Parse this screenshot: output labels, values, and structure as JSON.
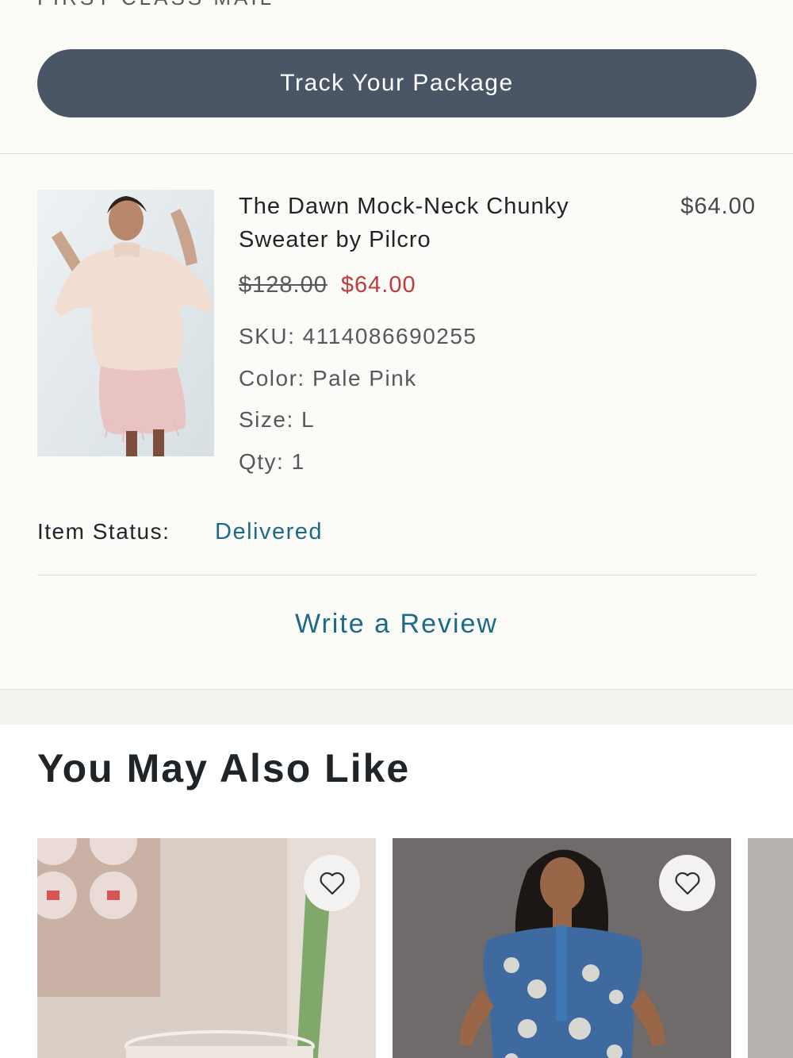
{
  "shipping": {
    "method_partial": "FIRST CLASS MAIL",
    "track_label": "Track Your Package"
  },
  "item": {
    "title_line1": "The Dawn Mock-Neck Chunky",
    "title_line2": "Sweater by Pilcro",
    "price": "$64.00",
    "original_price": "$128.00",
    "sale_price": "$64.00",
    "sku": "SKU: 4114086690255",
    "color": "Color: Pale Pink",
    "size": "Size: L",
    "qty": "Qty: 1",
    "status_label": "Item Status:",
    "status_value": "Delivered",
    "review_label": "Write a Review"
  },
  "recommendations": {
    "title": "You May Also Like"
  },
  "colors": {
    "button": "#4a5566",
    "link": "#1d6a88",
    "sale": "#c0393c"
  }
}
